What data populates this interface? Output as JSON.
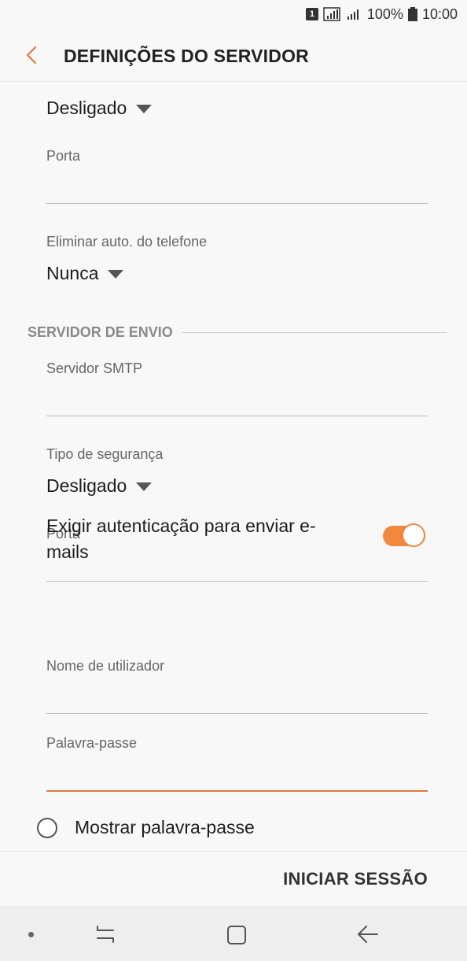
{
  "status_bar": {
    "sim": "1",
    "battery_percent": "100%",
    "time": "10:00"
  },
  "app_bar": {
    "title": "DEFINIÇÕES DO SERVIDOR",
    "back_icon": "chevron-left-icon",
    "accent_color": "#e47a3e"
  },
  "incoming": {
    "security_value": "Desligado",
    "port_label": "Porta",
    "port_value": "",
    "auto_delete_label": "Eliminar auto. do telefone",
    "auto_delete_value": "Nunca"
  },
  "outgoing": {
    "section_title": "SERVIDOR DE ENVIO",
    "smtp_label": "Servidor SMTP",
    "smtp_value": "",
    "security_label": "Tipo de segurança",
    "security_value": "Desligado",
    "port_label": "Porta",
    "port_value": "",
    "auth_label": "Exigir autenticação para enviar e-mails",
    "auth_enabled": true,
    "username_label": "Nome de utilizador",
    "username_value": "",
    "password_label": "Palavra-passe",
    "password_value": "",
    "show_password_label": "Mostrar palavra-passe",
    "show_password_checked": false
  },
  "actions": {
    "sign_in_label": "INICIAR SESSÃO"
  },
  "colors": {
    "switch_on": "#f2873f",
    "focus_underline": "#e47a3e"
  }
}
